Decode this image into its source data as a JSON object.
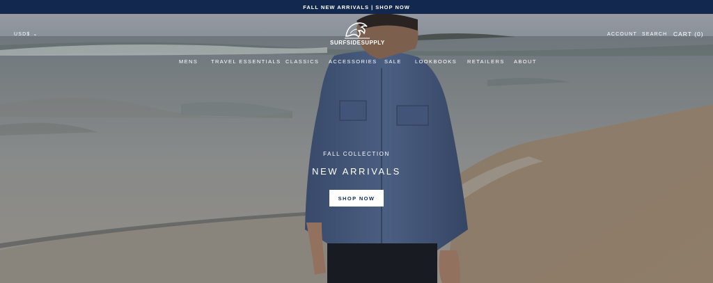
{
  "announcement": {
    "text": "FALL NEW ARRIVALS | SHOP NOW"
  },
  "header": {
    "currency": "USD$",
    "logo_text": "SURFSIDESUPPLY",
    "account": "ACCOUNT",
    "search": "SEARCH",
    "cart": "CART (0)"
  },
  "nav": {
    "items": [
      {
        "label": "MENS"
      },
      {
        "label": "TRAVEL ESSENTIALS"
      },
      {
        "label": "CLASSICS"
      },
      {
        "label": "ACCESSORIES"
      },
      {
        "label": "SALE"
      },
      {
        "label": "LOOKBOOKS"
      },
      {
        "label": "RETAILERS"
      },
      {
        "label": "ABOUT"
      }
    ]
  },
  "hero": {
    "eyebrow": "FALL COLLECTION",
    "headline": "NEW ARRIVALS",
    "cta": "SHOP NOW"
  },
  "colors": {
    "announcement_bg": "#13284f",
    "cta_text": "#13284f",
    "cta_bg": "#ffffff"
  }
}
